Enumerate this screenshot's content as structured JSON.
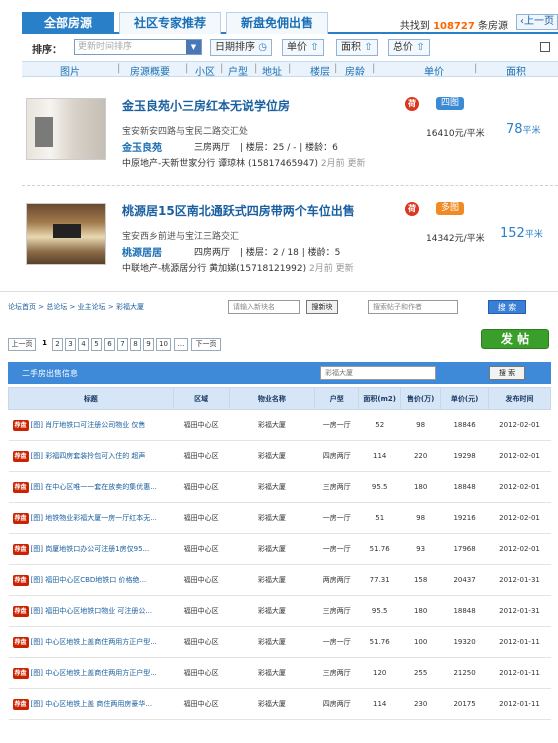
{
  "tabs": [
    {
      "label": "全部房源"
    },
    {
      "label": "社区专家推荐"
    },
    {
      "label": "新盘免佣出售"
    }
  ],
  "total": {
    "prefix": "共找到",
    "count": "108727",
    "suffix": "条房源"
  },
  "prev_page_top": "上一页",
  "sort": {
    "label": "排序：",
    "select_value": "更新时间排序",
    "buttons": [
      "日期排序",
      "单价",
      "面积",
      "总价"
    ]
  },
  "columns": [
    "图片",
    "房源概要",
    "小区",
    "户型",
    "地址",
    "楼层",
    "房龄",
    "单价",
    "面积"
  ],
  "listings": [
    {
      "title": "金玉良苑小三房红本无说学位房",
      "badge": "荷",
      "pic": "四图",
      "addr": "宝安新安四路与宝民二路交汇处",
      "price": "16410元/平米",
      "area": "78",
      "area_unit": "平米",
      "community": "金玉良苑",
      "layout": "三房两厅",
      "floor": "楼层：25 / -",
      "age": "楼龄：6",
      "agent": "中原地产-天新世家分行 谭琼林 (15817465947)",
      "time": "2月前 更新"
    },
    {
      "title": "桃源居15区南北通跃式四房带两个车位出售",
      "badge": "荷",
      "pic": "多图",
      "addr": "宝安西乡前进与宝江三路交汇",
      "price": "14342元/平米",
      "area": "152",
      "area_unit": "平米",
      "community": "桃源居居",
      "layout": "四房两厅",
      "floor": "楼层：2 / 18",
      "age": "楼龄：5",
      "agent": "中联地产-桃源居分行 黄加娣(15718121992)",
      "time": "2月前 更新"
    }
  ],
  "bottom": {
    "breadcrumb": "论坛首页 > 总论坛 > 业主论坛 > 彩福大厦",
    "new_post_placeholder": "请输入新块名",
    "search_block_btn": "搜新块",
    "search_post_placeholder": "搜索帖子和作者",
    "search_btn": "搜 索",
    "pager_prev": "上一页",
    "pages": [
      "1",
      "2",
      "3",
      "4",
      "5",
      "6",
      "7",
      "8",
      "9",
      "10",
      "...",
      "下一页"
    ],
    "post_btn": "发 帖",
    "panel_title": "二手房出售信息",
    "panel_search_value": "彩福大厦",
    "panel_search_btn": "搜 索",
    "headers": [
      "标题",
      "区域",
      "物业名称",
      "户型",
      "面积(m2)",
      "售价(万)",
      "单价(元)",
      "发布时间"
    ],
    "tag_label": "荐盘",
    "rows": [
      {
        "title": "[图] 肖厅地铁口可注册公司物业 仅售",
        "region": "福田中心区",
        "name": "彩福大厦",
        "layout": "一房一厅",
        "area": "52",
        "price": "98",
        "unit": "18846",
        "date": "2012-02-01"
      },
      {
        "title": "[图] 彩福四房套装拎包可入住的 超声",
        "region": "福田中心区",
        "name": "彩福大厦",
        "layout": "四房两厅",
        "area": "114",
        "price": "220",
        "unit": "19298",
        "date": "2012-02-01"
      },
      {
        "title": "[图] 在中心区唯一一套在放卖的集优惠...",
        "region": "福田中心区",
        "name": "彩福大厦",
        "layout": "三房两厅",
        "area": "95.5",
        "price": "180",
        "unit": "18848",
        "date": "2012-02-01"
      },
      {
        "title": "[图] 地铁物业彩福大厦一房一厅红本无...",
        "region": "福田中心区",
        "name": "彩福大厦",
        "layout": "一房一厅",
        "area": "51",
        "price": "98",
        "unit": "19216",
        "date": "2012-02-01"
      },
      {
        "title": "[图] 岗厦地铁口办公可注册1房仅95...",
        "region": "福田中心区",
        "name": "彩福大厦",
        "layout": "一房一厅",
        "area": "51.76",
        "price": "93",
        "unit": "17968",
        "date": "2012-02-01"
      },
      {
        "title": "[图] 福田中心区CBD地铁口 价格绝...",
        "region": "福田中心区",
        "name": "彩福大厦",
        "layout": "两房两厅",
        "area": "77.31",
        "price": "158",
        "unit": "20437",
        "date": "2012-01-31"
      },
      {
        "title": "[图] 福田中心区地铁口物业 可注册公...",
        "region": "福田中心区",
        "name": "彩福大厦",
        "layout": "三房两厅",
        "area": "95.5",
        "price": "180",
        "unit": "18848",
        "date": "2012-01-31"
      },
      {
        "title": "[图] 中心区地铁上盖商住两用方正户型...",
        "region": "福田中心区",
        "name": "彩福大厦",
        "layout": "一房一厅",
        "area": "51.76",
        "price": "100",
        "unit": "19320",
        "date": "2012-01-11"
      },
      {
        "title": "[图] 中心区地铁上盖商住两用方正户型...",
        "region": "福田中心区",
        "name": "彩福大厦",
        "layout": "三房两厅",
        "area": "120",
        "price": "255",
        "unit": "21250",
        "date": "2012-01-11"
      },
      {
        "title": "[图] 中心区地铁上盖 商住两用房豪华...",
        "region": "福田中心区",
        "name": "彩福大厦",
        "layout": "四房两厅",
        "area": "114",
        "price": "230",
        "unit": "20175",
        "date": "2012-01-11"
      }
    ]
  }
}
